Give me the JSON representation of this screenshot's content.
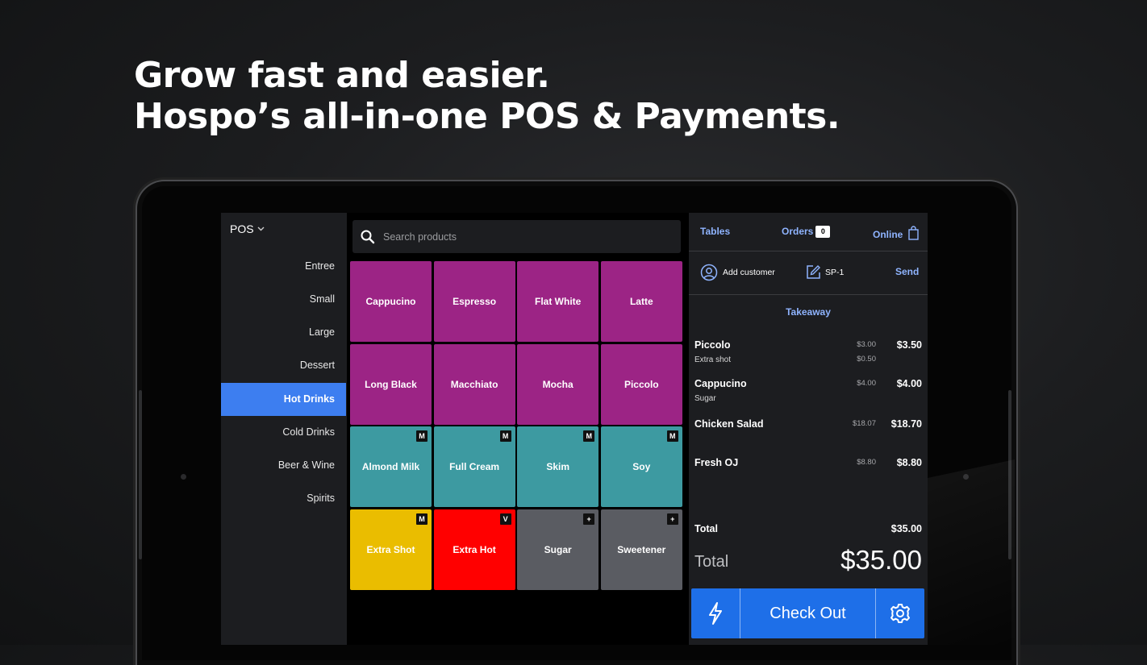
{
  "headline": {
    "line1": "Grow fast and easier.",
    "line2": "Hospo’s all-in-one POS & Payments."
  },
  "sidebar": {
    "pos_label": "POS",
    "categories": [
      "Entree",
      "Small",
      "Large",
      "Dessert",
      "Hot Drinks",
      "Cold Drinks",
      "Beer & Wine",
      "Spirits"
    ],
    "active_category": "Hot Drinks"
  },
  "search": {
    "placeholder": "Search products",
    "value": ""
  },
  "products": [
    {
      "label": "Cappucino",
      "color": "#9c2485",
      "badge": ""
    },
    {
      "label": "Espresso",
      "color": "#9c2485",
      "badge": ""
    },
    {
      "label": "Flat White",
      "color": "#9c2485",
      "badge": ""
    },
    {
      "label": "Latte",
      "color": "#9c2485",
      "badge": ""
    },
    {
      "label": "Long Black",
      "color": "#9c2485",
      "badge": ""
    },
    {
      "label": "Macchiato",
      "color": "#9c2485",
      "badge": ""
    },
    {
      "label": "Mocha",
      "color": "#9c2485",
      "badge": ""
    },
    {
      "label": "Piccolo",
      "color": "#9c2485",
      "badge": ""
    },
    {
      "label": "Almond Milk",
      "color": "#3d9aa1",
      "badge": "M"
    },
    {
      "label": "Full Cream",
      "color": "#3d9aa1",
      "badge": "M"
    },
    {
      "label": "Skim",
      "color": "#3d9aa1",
      "badge": "M"
    },
    {
      "label": "Soy",
      "color": "#3d9aa1",
      "badge": "M"
    },
    {
      "label": "Extra Shot",
      "color": "#eabd00",
      "badge": "M"
    },
    {
      "label": "Extra Hot",
      "color": "#ff0000",
      "badge": "V"
    },
    {
      "label": "Sugar",
      "color": "#5a5c62",
      "badge": "+"
    },
    {
      "label": "Sweetener",
      "color": "#5a5c62",
      "badge": "+"
    }
  ],
  "order": {
    "tabs": {
      "tables": "Tables",
      "orders": "Orders",
      "orders_count": "0",
      "online": "Online"
    },
    "customer": {
      "add_customer": "Add customer",
      "order_ref": "SP-1",
      "send": "Send"
    },
    "type": "Takeaway",
    "lines": [
      {
        "name": "Piccolo",
        "modifier": "Extra shot",
        "unit_price": "$3.00",
        "modifier_price": "$0.50",
        "total": "$3.50"
      },
      {
        "name": "Cappucino",
        "modifier": "Sugar",
        "unit_price": "$4.00",
        "modifier_price": "",
        "total": "$4.00"
      },
      {
        "name": "Chicken Salad",
        "modifier": "",
        "unit_price": "$18.07",
        "modifier_price": "",
        "total": "$18.70"
      },
      {
        "name": "Fresh OJ",
        "modifier": "",
        "unit_price": "$8.80",
        "modifier_price": "",
        "total": "$8.80"
      }
    ],
    "total_label": "Total",
    "total_value": "$35.00",
    "big_total_label": "Total",
    "big_total_value": "$35.00",
    "checkout_label": "Check Out"
  },
  "colors": {
    "accent": "#3d7ef0",
    "link": "#8fb4ff",
    "checkout": "#1e6fe8"
  },
  "icons": [
    "search-icon",
    "chevron-down-icon",
    "shopping-bag-icon",
    "user-circle-icon",
    "edit-icon",
    "lightning-icon",
    "gear-icon",
    "plus-icon"
  ]
}
